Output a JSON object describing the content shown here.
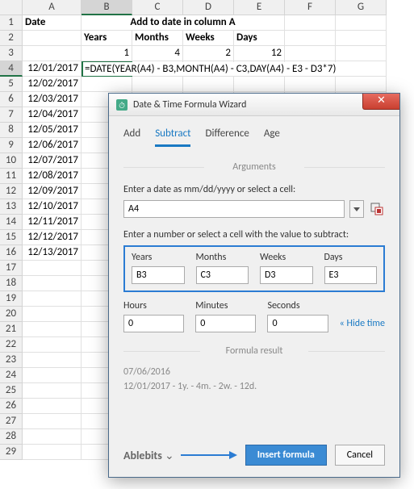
{
  "columns": [
    "A",
    "B",
    "C",
    "D",
    "E",
    "F",
    "G"
  ],
  "rows": [
    1,
    2,
    3,
    4,
    5,
    6,
    7,
    8,
    9,
    10,
    11,
    12,
    13,
    14,
    15,
    16,
    17,
    18,
    19,
    20,
    21,
    22,
    23,
    24,
    25,
    26,
    27,
    28,
    29
  ],
  "header": {
    "a1": "Date",
    "merged_title": "Add to date in column A",
    "b2": "Years",
    "c2": "Months",
    "d2": "Weeks",
    "e2": "Days",
    "b3": 1,
    "c3": 4,
    "d3": 2,
    "e3": 12
  },
  "dates": [
    "12/01/2017",
    "12/02/2017",
    "12/03/2017",
    "12/04/2017",
    "12/05/2017",
    "12/06/2017",
    "12/07/2017",
    "12/08/2017",
    "12/09/2017",
    "12/10/2017",
    "12/11/2017",
    "12/12/2017",
    "12/13/2017"
  ],
  "formula": "=DATE(YEAR(A4) - B3,MONTH(A4) - C3,DAY(A4) - E3 - D3*7)",
  "dialog": {
    "title": "Date & Time Formula Wizard",
    "tabs": {
      "add": "Add",
      "subtract": "Subtract",
      "difference": "Difference",
      "age": "Age"
    },
    "section_args": "Arguments",
    "label_date": "Enter a date as mm/dd/yyyy or select a cell:",
    "date_value": "A4",
    "label_number": "Enter a number or select a cell with the value to subtract:",
    "fields": {
      "years": {
        "label": "Years",
        "value": "B3"
      },
      "months": {
        "label": "Months",
        "value": "C3"
      },
      "weeks": {
        "label": "Weeks",
        "value": "D3"
      },
      "days": {
        "label": "Days",
        "value": "E3"
      },
      "hours": {
        "label": "Hours",
        "value": "0"
      },
      "minutes": {
        "label": "Minutes",
        "value": "0"
      },
      "seconds": {
        "label": "Seconds",
        "value": "0"
      }
    },
    "hide_time": "Hide time",
    "section_result": "Formula result",
    "result_line1": "07/06/2016",
    "result_line2": "12/01/2017 - 1y. - 4m. - 2w. - 12d.",
    "brand": "Ablebits",
    "insert": "Insert formula",
    "cancel": "Cancel"
  }
}
